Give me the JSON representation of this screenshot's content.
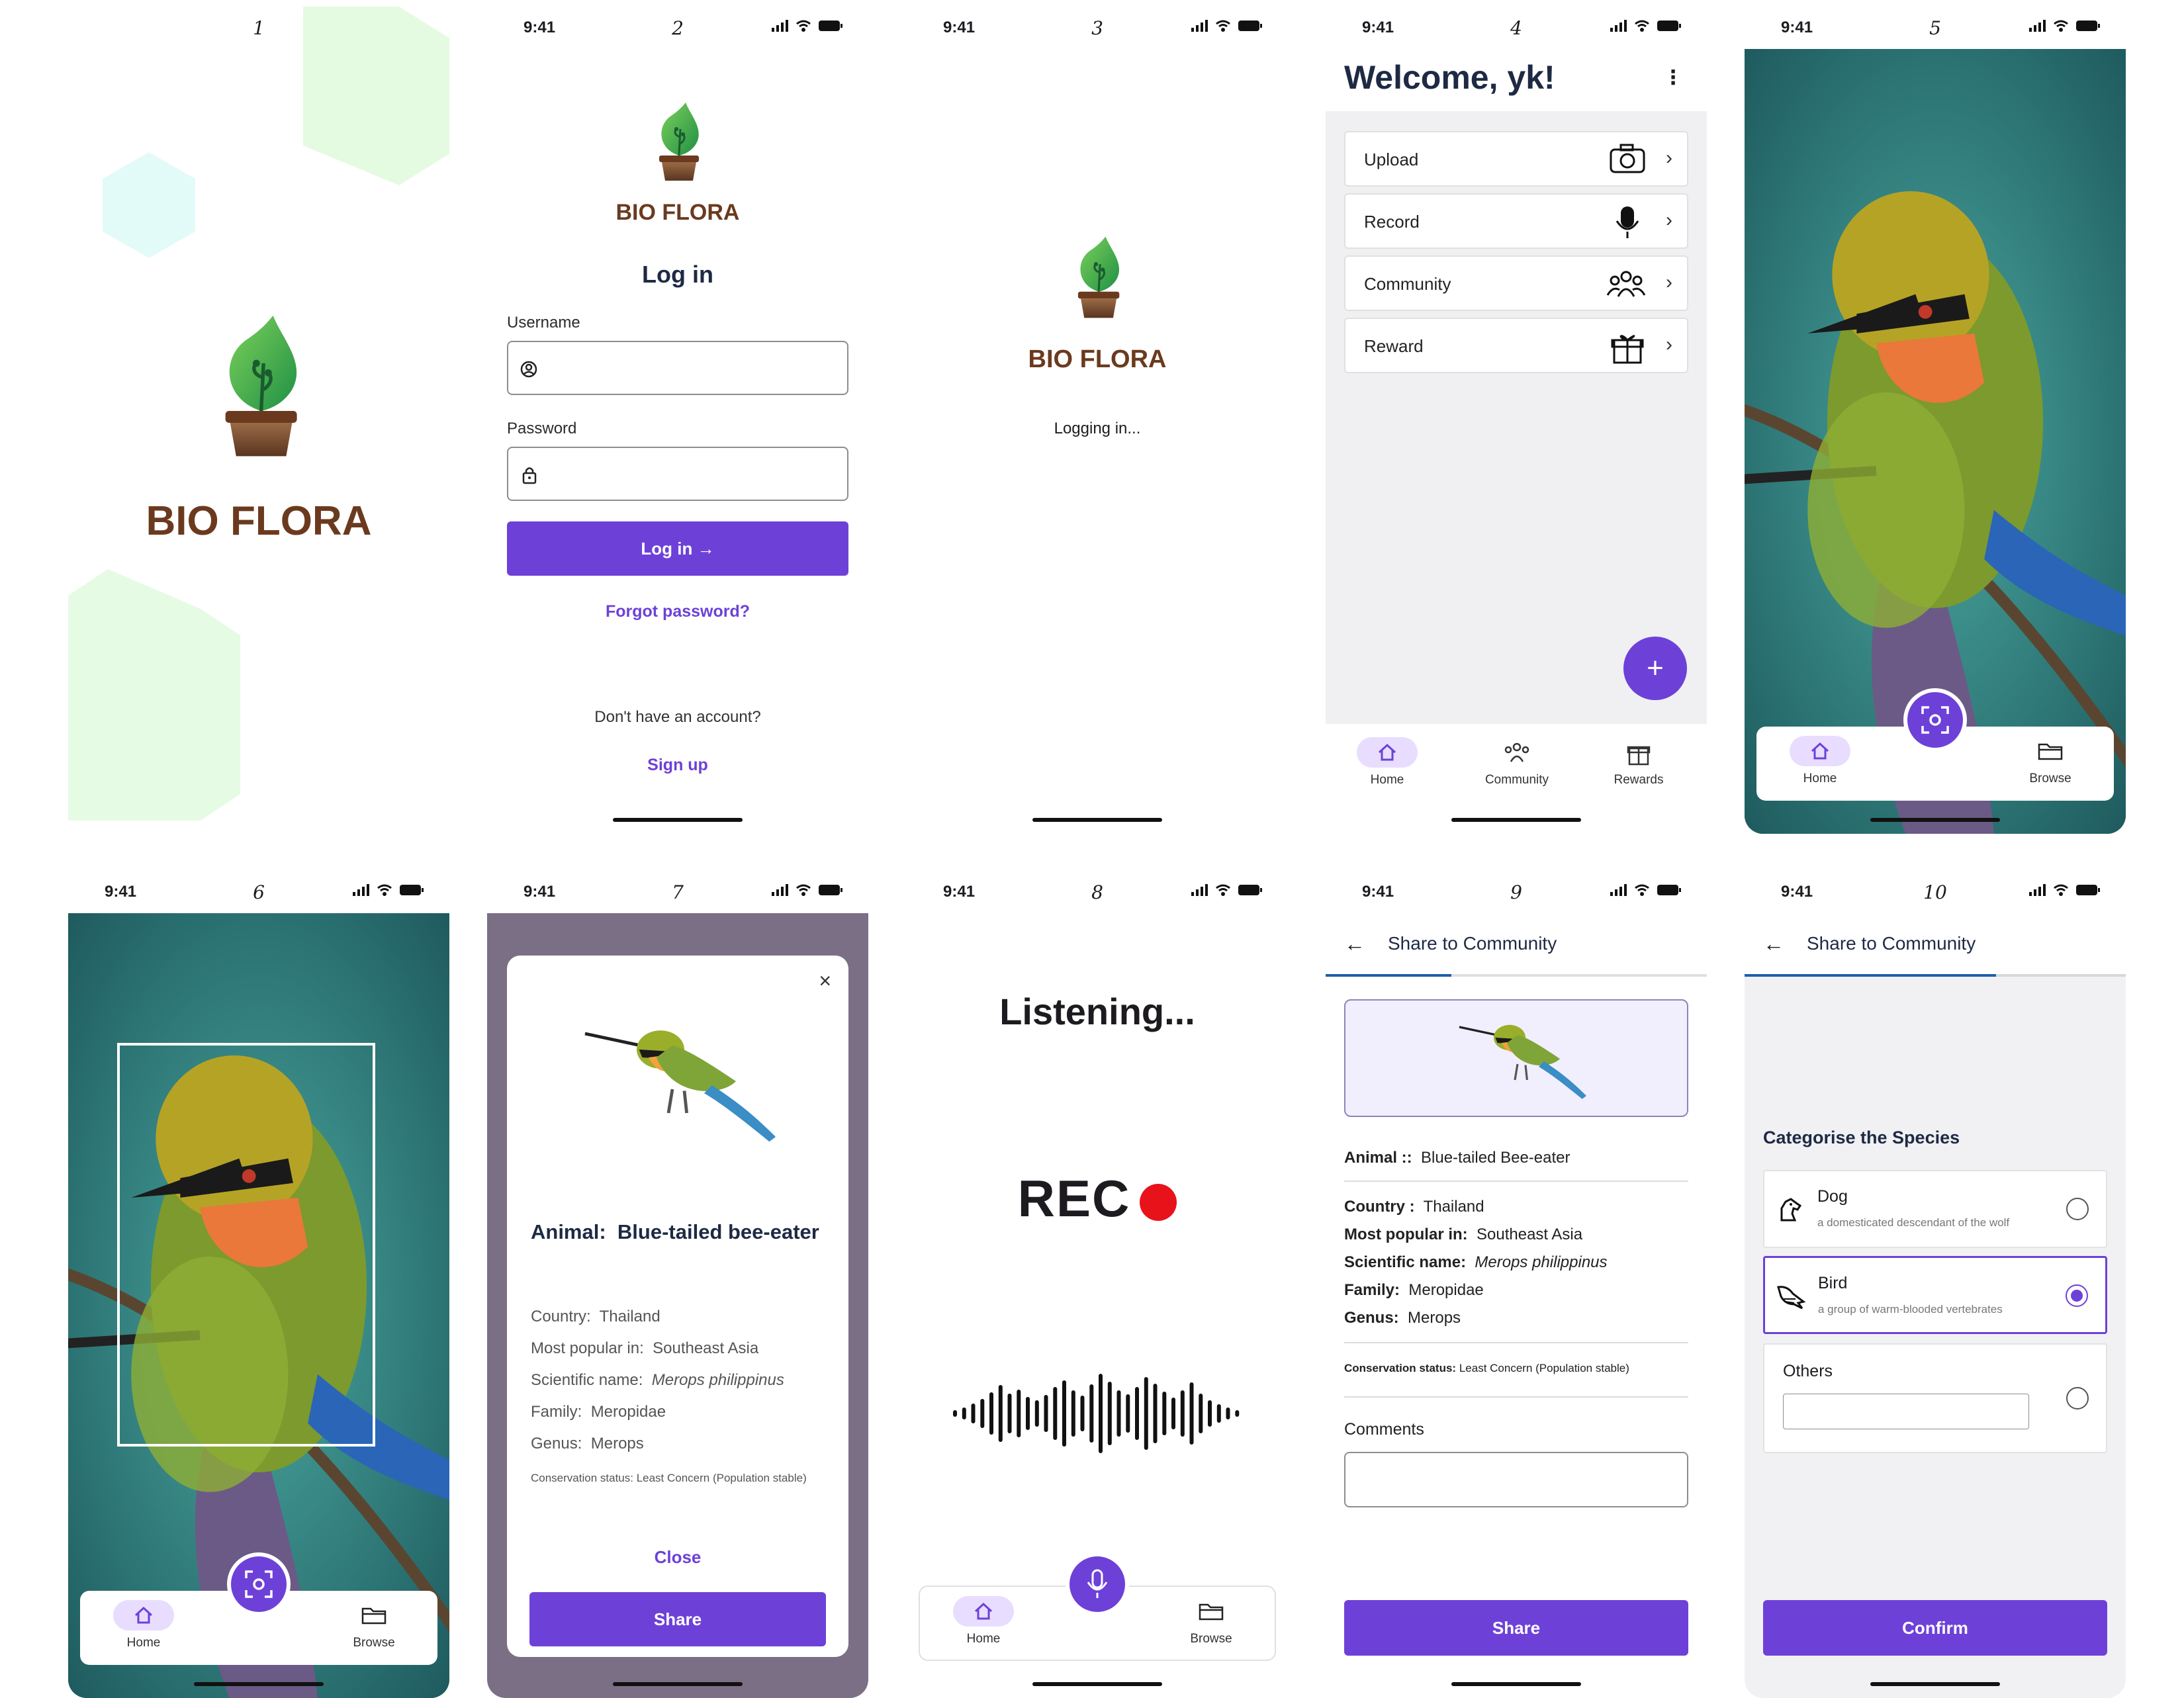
{
  "status": {
    "time": "9:41"
  },
  "screens": [
    {
      "number": "1",
      "logo_text": "BIO FLORA"
    },
    {
      "number": "2",
      "logo_text": "BIO FLORA",
      "title": "Log in",
      "username_label": "Username",
      "password_label": "Password",
      "login_button": "Log in",
      "forgot": "Forgot password?",
      "no_account": "Don't have an account?",
      "signup": "Sign up"
    },
    {
      "number": "3",
      "logo_text": "BIO FLORA",
      "message": "Logging in..."
    },
    {
      "number": "4",
      "welcome": "Welcome, yk!",
      "menu": [
        {
          "label": "Upload",
          "icon": "camera-icon"
        },
        {
          "label": "Record",
          "icon": "microphone-icon"
        },
        {
          "label": "Community",
          "icon": "people-icon"
        },
        {
          "label": "Reward",
          "icon": "gift-icon"
        }
      ],
      "nav": [
        "Home",
        "Community",
        "Rewards"
      ]
    },
    {
      "number": "5",
      "nav": [
        "Home",
        "Browse"
      ]
    },
    {
      "number": "6",
      "nav": [
        "Home",
        "Browse"
      ]
    },
    {
      "number": "7",
      "animal_label": "Animal:",
      "animal_value": "Blue-tailed bee-eater",
      "details": [
        {
          "k": "Country:",
          "v": "Thailand"
        },
        {
          "k": "Most popular in:",
          "v": "Southeast Asia"
        },
        {
          "k": "Scientific name:",
          "v": "Merops philippinus"
        },
        {
          "k": "Family:",
          "v": "Meropidae"
        },
        {
          "k": "Genus:",
          "v": "Merops"
        }
      ],
      "conservation": "Conservation status: Least Concern (Population stable)",
      "close": "Close",
      "share": "Share"
    },
    {
      "number": "8",
      "listening": "Listening...",
      "rec": "REC",
      "nav": [
        "Home",
        "Browse"
      ]
    },
    {
      "number": "9",
      "header": "Share to Community",
      "animal_label": "Animal ::",
      "animal_value": "Blue-tailed Bee-eater",
      "details": [
        {
          "k": "Country :",
          "v": "Thailand"
        },
        {
          "k": "Most popular in:",
          "v": "Southeast Asia"
        },
        {
          "k": "Scientific name:",
          "v": "Merops philippinus"
        },
        {
          "k": "Family:",
          "v": "Meropidae"
        },
        {
          "k": "Genus:",
          "v": "Merops"
        }
      ],
      "conservation_label": "Conservation status:",
      "conservation_value": "Least Concern (Population stable)",
      "comments": "Comments",
      "share": "Share"
    },
    {
      "number": "10",
      "header": "Share to Community",
      "categorise": "Categorise the Species",
      "options": [
        {
          "title": "Dog",
          "desc": "a domesticated descendant of the wolf"
        },
        {
          "title": "Bird",
          "desc": "a group of warm-blooded vertebrates"
        },
        {
          "title": "Others",
          "desc": ""
        }
      ],
      "confirm": "Confirm"
    }
  ],
  "colors": {
    "primary": "#6d41d8",
    "brown": "#6b3a1e",
    "leaf": "#3aa84a",
    "pill": "#e8ddff"
  }
}
